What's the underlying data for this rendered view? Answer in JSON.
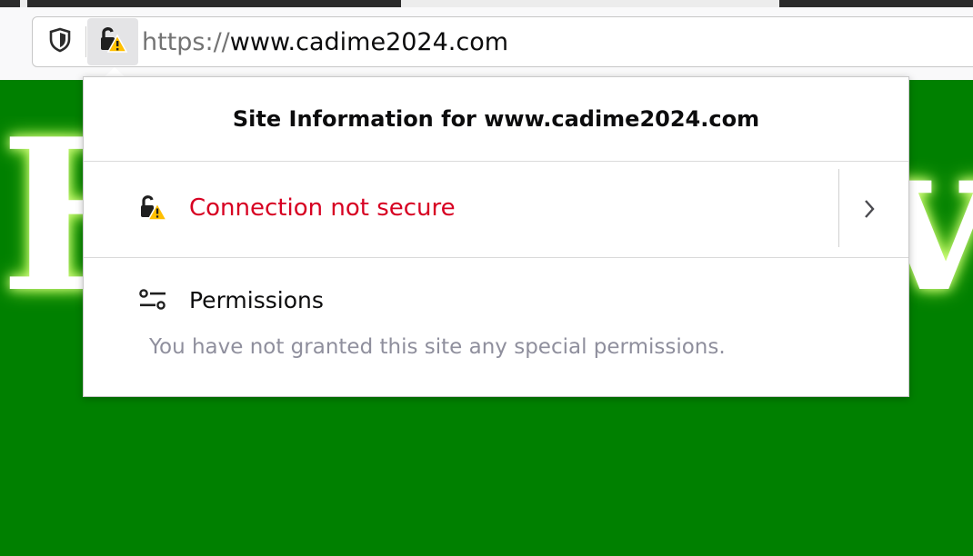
{
  "browser": {
    "url_scheme": "https://",
    "url_host": "www.cadime2024.com",
    "icons": {
      "tracking": "shield-icon",
      "site_identity": "insecure-lock-warning-icon"
    }
  },
  "page": {
    "heading_visible_letters": [
      "H",
      "vo"
    ],
    "background_color": "#008000",
    "heading_glow_color": "#b8ff40"
  },
  "site_info_panel": {
    "title": "Site Information for www.cadime2024.com",
    "security": {
      "label": "Connection not secure",
      "label_color": "#d70022",
      "icon": "insecure-lock-warning-icon",
      "more_icon": "chevron-right-icon"
    },
    "permissions": {
      "title": "Permissions",
      "icon": "permissions-sliders-icon",
      "description": "You have not granted this site any special permissions."
    }
  }
}
